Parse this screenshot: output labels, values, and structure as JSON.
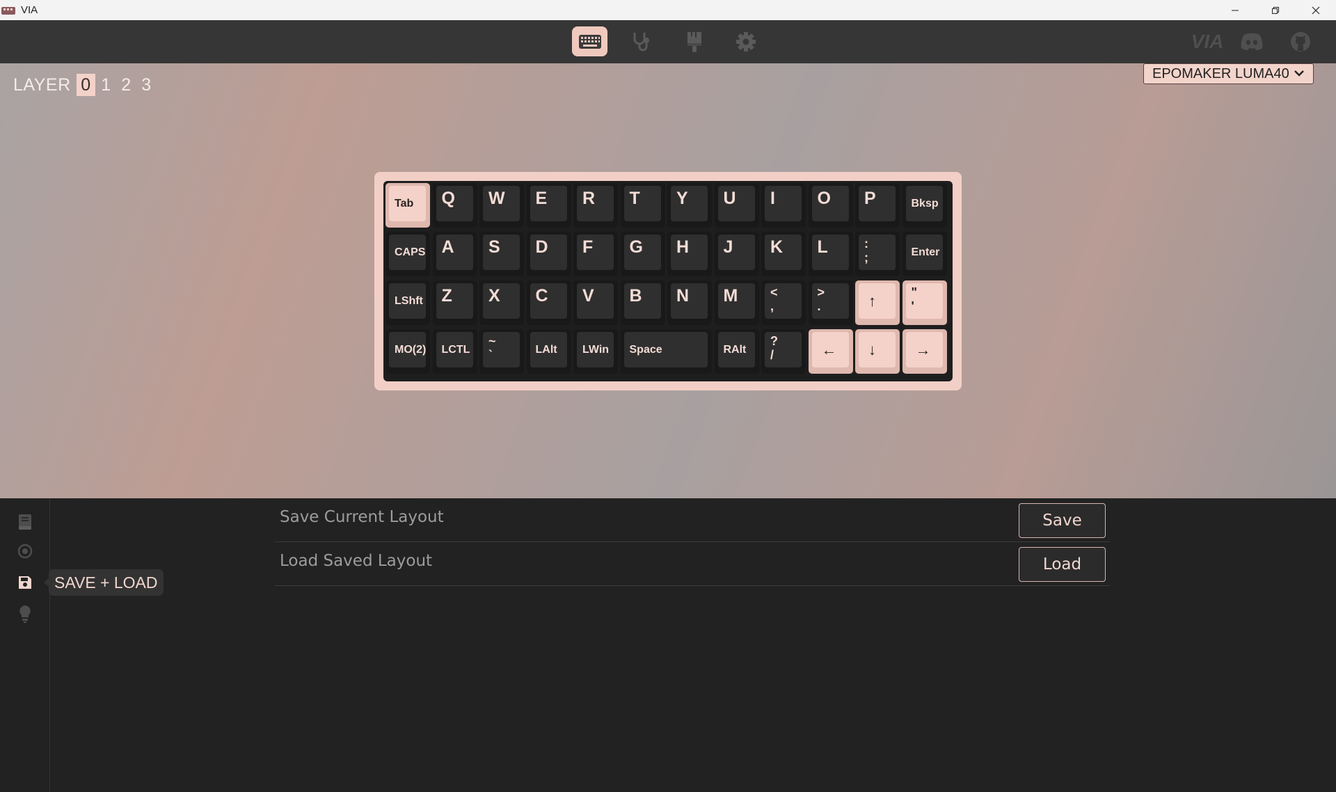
{
  "window": {
    "title": "VIA",
    "controls": [
      "minimize",
      "restore",
      "close"
    ]
  },
  "toolbar": {
    "tabs": [
      {
        "name": "configure",
        "icon": "keyboard-icon",
        "active": true
      },
      {
        "name": "test",
        "icon": "stethoscope-icon",
        "active": false
      },
      {
        "name": "design",
        "icon": "brush-icon",
        "active": false
      },
      {
        "name": "settings",
        "icon": "gear-icon",
        "active": false
      }
    ],
    "right_icons": [
      "via-logo",
      "discord-icon",
      "github-icon"
    ],
    "logo_text": "VIA"
  },
  "layers": {
    "label": "LAYER",
    "items": [
      "0",
      "1",
      "2",
      "3"
    ],
    "active": "0"
  },
  "keyboard_select": {
    "value": "EPOMAKER LUMA40"
  },
  "keys": {
    "row1": [
      "Tab",
      "Q",
      "W",
      "E",
      "R",
      "T",
      "Y",
      "U",
      "I",
      "O",
      "P",
      "Bksp"
    ],
    "row2": [
      "CAPS",
      "A",
      "S",
      "D",
      "F",
      "G",
      "H",
      "J",
      "K",
      "L",
      ":\n;",
      "Enter"
    ],
    "row3": [
      "LShft",
      "Z",
      "X",
      "C",
      "V",
      "B",
      "N",
      "M",
      "<\n,",
      ">\n.",
      "↑",
      "\"\n'"
    ],
    "row4": [
      "MO(2)",
      "LCTL",
      "~\n`",
      "LAlt",
      "LWin",
      "Space",
      "RAlt",
      "?\n/",
      "←",
      "↓",
      "→"
    ]
  },
  "colors": {
    "accent": "#f2cfc6",
    "keycap_dark": "#2f2f2f",
    "keycap_light": "#f4d2c9",
    "legend_dark": "#f4dcd6",
    "bottom_bg": "#222222",
    "toolbar_bg": "#363636"
  },
  "sidebar": {
    "items": [
      {
        "name": "layouts",
        "icon": "book-icon"
      },
      {
        "name": "macros",
        "icon": "record-icon"
      },
      {
        "name": "save-load",
        "icon": "save-icon",
        "active": true
      },
      {
        "name": "tips",
        "icon": "lightbulb-icon"
      }
    ],
    "tooltip": "SAVE + LOAD"
  },
  "save_load": {
    "save_label": "Save Current Layout",
    "save_button": "Save",
    "load_label": "Load Saved Layout",
    "load_button": "Load"
  }
}
